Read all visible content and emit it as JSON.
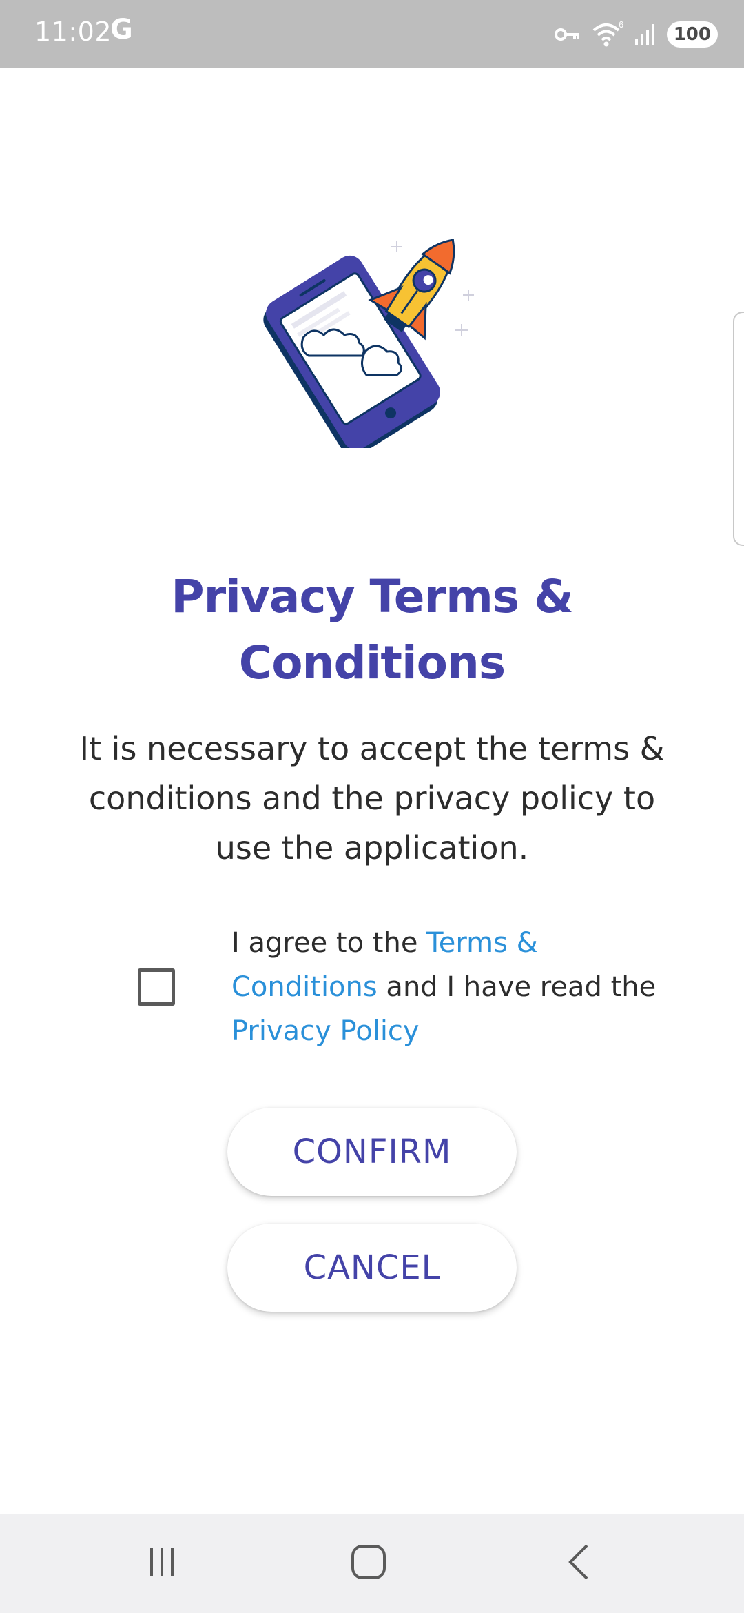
{
  "status_bar": {
    "time": "11:02",
    "carrier_icon_text": "G",
    "network_badge": "6",
    "battery": "100",
    "icons": [
      "vpn-key-icon",
      "wifi-icon",
      "signal-icon",
      "battery-icon"
    ]
  },
  "illustration": {
    "name": "phone-rocket-illustration"
  },
  "main": {
    "title": "Privacy Terms & Conditions",
    "description": "It is necessary to accept the terms & conditions and the privacy policy to use the application.",
    "agreement": {
      "checked": false,
      "text_1": "I agree to the ",
      "terms_link": "Terms & Conditions",
      "text_2": " and I have read the ",
      "privacy_link": "Privacy Policy"
    },
    "buttons": {
      "confirm": "CONFIRM",
      "cancel": "CANCEL"
    }
  },
  "nav_bar": {
    "icons": [
      "recent-apps-icon",
      "home-icon",
      "back-icon"
    ]
  },
  "colors": {
    "primary": "#4443a8",
    "link": "#2a90d9",
    "text": "#2c2c2c",
    "status_bar": "#bdbdbd",
    "nav_bar": "#f0f0f2",
    "rocket_yellow": "#f7c233",
    "rocket_orange": "#f26b2e"
  }
}
